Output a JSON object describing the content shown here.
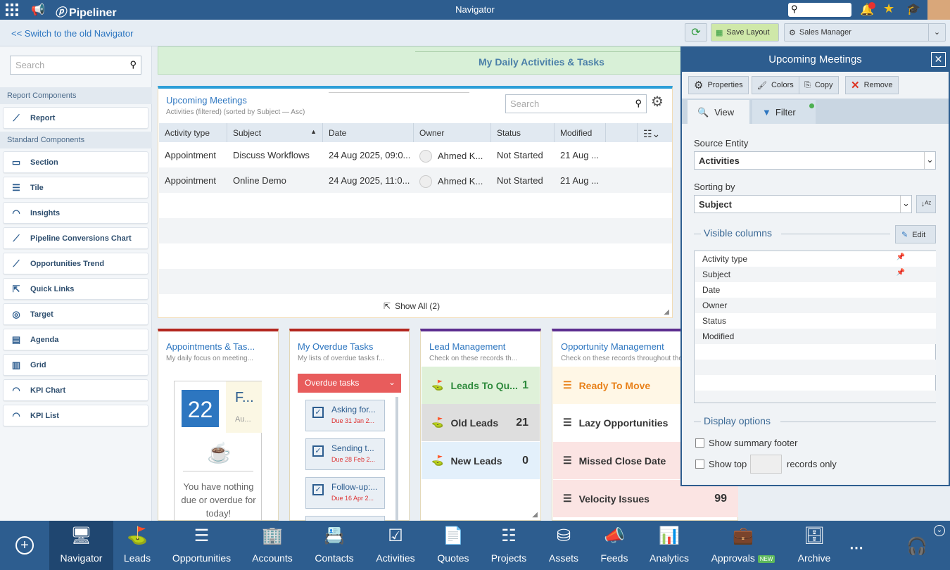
{
  "topbar": {
    "logo": "Pipeliner",
    "title": "Navigator"
  },
  "bar2": {
    "old_nav_link": "<< Switch to the old Navigator",
    "save_layout": "Save Layout",
    "profile": "Sales Manager"
  },
  "left": {
    "search_placeholder": "Search",
    "report_section": "Report Components",
    "report_items": [
      {
        "label": "Report",
        "icon": "chart-line-icon"
      }
    ],
    "standard_section": "Standard Components",
    "standard_items": [
      {
        "label": "Section"
      },
      {
        "label": "Tile"
      },
      {
        "label": "Insights"
      },
      {
        "label": "Pipeline Conversions Chart"
      },
      {
        "label": "Opportunities Trend"
      },
      {
        "label": "Quick Links"
      },
      {
        "label": "Target"
      },
      {
        "label": "Agenda"
      },
      {
        "label": "Grid"
      },
      {
        "label": "KPI Chart"
      },
      {
        "label": "KPI List"
      }
    ]
  },
  "main": {
    "banner_title": "My Daily Activities & Tasks",
    "meetings": {
      "title": "Upcoming Meetings",
      "subtitle": "Activities (filtered) (sorted by Subject — Asc)",
      "search_placeholder": "Search",
      "columns": [
        "Activity type",
        "Subject",
        "Date",
        "Owner",
        "Status",
        "Modified"
      ],
      "rows": [
        {
          "type": "Appointment",
          "subject": "Discuss Workflows",
          "date": "24 Aug 2025, 09:0...",
          "owner": "Ahmed K...",
          "status": "Not Started",
          "modified": "21 Aug ..."
        },
        {
          "type": "Appointment",
          "subject": "Online Demo",
          "date": "24 Aug 2025, 11:0...",
          "owner": "Ahmed K...",
          "status": "Not Started",
          "modified": "21 Aug ..."
        }
      ],
      "show_all": "Show All (2)"
    },
    "appointments": {
      "title": "Appointments & Tas...",
      "subtitle": "My daily focus on meeting...",
      "day": "22",
      "weekday": "F...",
      "month": "Au...",
      "empty_text": "You have nothing due or overdue for today!"
    },
    "overdue": {
      "title": "My Overdue Tasks",
      "subtitle": "My lists of overdue tasks f...",
      "dropdown": "Overdue tasks",
      "tasks": [
        {
          "title": "Asking for...",
          "due": "Due 31 Jan 2..."
        },
        {
          "title": "Sending t...",
          "due": "Due 28 Feb 2..."
        },
        {
          "title": "Follow-up:...",
          "due": "Due 16 Apr 2..."
        }
      ]
    },
    "leads": {
      "title": "Lead Management",
      "subtitle": "Check on these records th...",
      "items": [
        {
          "label": "Leads To Qu...",
          "value": "1"
        },
        {
          "label": "Old Leads",
          "value": "21"
        },
        {
          "label": "New Leads",
          "value": "0"
        }
      ]
    },
    "opps": {
      "title": "Opportunity Management",
      "subtitle": "Check on these records throughout the",
      "items": [
        {
          "label": "Ready To Move",
          "value": ""
        },
        {
          "label": "Lazy Opportunities",
          "value": ""
        },
        {
          "label": "Missed Close Date",
          "value": ""
        },
        {
          "label": "Velocity Issues",
          "value": "99"
        }
      ]
    }
  },
  "panel": {
    "title": "Upcoming Meetings",
    "toolbar": {
      "properties": "Properties",
      "colors": "Colors",
      "copy": "Copy",
      "remove": "Remove"
    },
    "tabs": {
      "view": "View",
      "filter": "Filter"
    },
    "source_label": "Source Entity",
    "source_value": "Activities",
    "sorting_label": "Sorting by",
    "sorting_value": "Subject",
    "visible_columns": "Visible columns",
    "edit": "Edit",
    "columns": [
      "Activity type",
      "Subject",
      "Date",
      "Owner",
      "Status",
      "Modified"
    ],
    "display_options": "Display options",
    "summary_footer": "Show summary footer",
    "show_top": "Show top",
    "records_only": "records only"
  },
  "bottom": {
    "items": [
      {
        "label": "Navigator",
        "icon": "monitor-chart-icon"
      },
      {
        "label": "Leads",
        "icon": "flag-icon"
      },
      {
        "label": "Opportunities",
        "icon": "stack-icon"
      },
      {
        "label": "Accounts",
        "icon": "buildings-icon"
      },
      {
        "label": "Contacts",
        "icon": "contact-card-icon"
      },
      {
        "label": "Activities",
        "icon": "checklist-icon"
      },
      {
        "label": "Quotes",
        "icon": "document-icon"
      },
      {
        "label": "Projects",
        "icon": "list-check-icon"
      },
      {
        "label": "Assets",
        "icon": "database-icon"
      },
      {
        "label": "Feeds",
        "icon": "feed-icon"
      },
      {
        "label": "Analytics",
        "icon": "bar-chart-icon"
      },
      {
        "label": "Approvals",
        "icon": "briefcase-icon"
      },
      {
        "label": "Archive",
        "icon": "archive-icon"
      }
    ],
    "new_badge": "NEW"
  }
}
